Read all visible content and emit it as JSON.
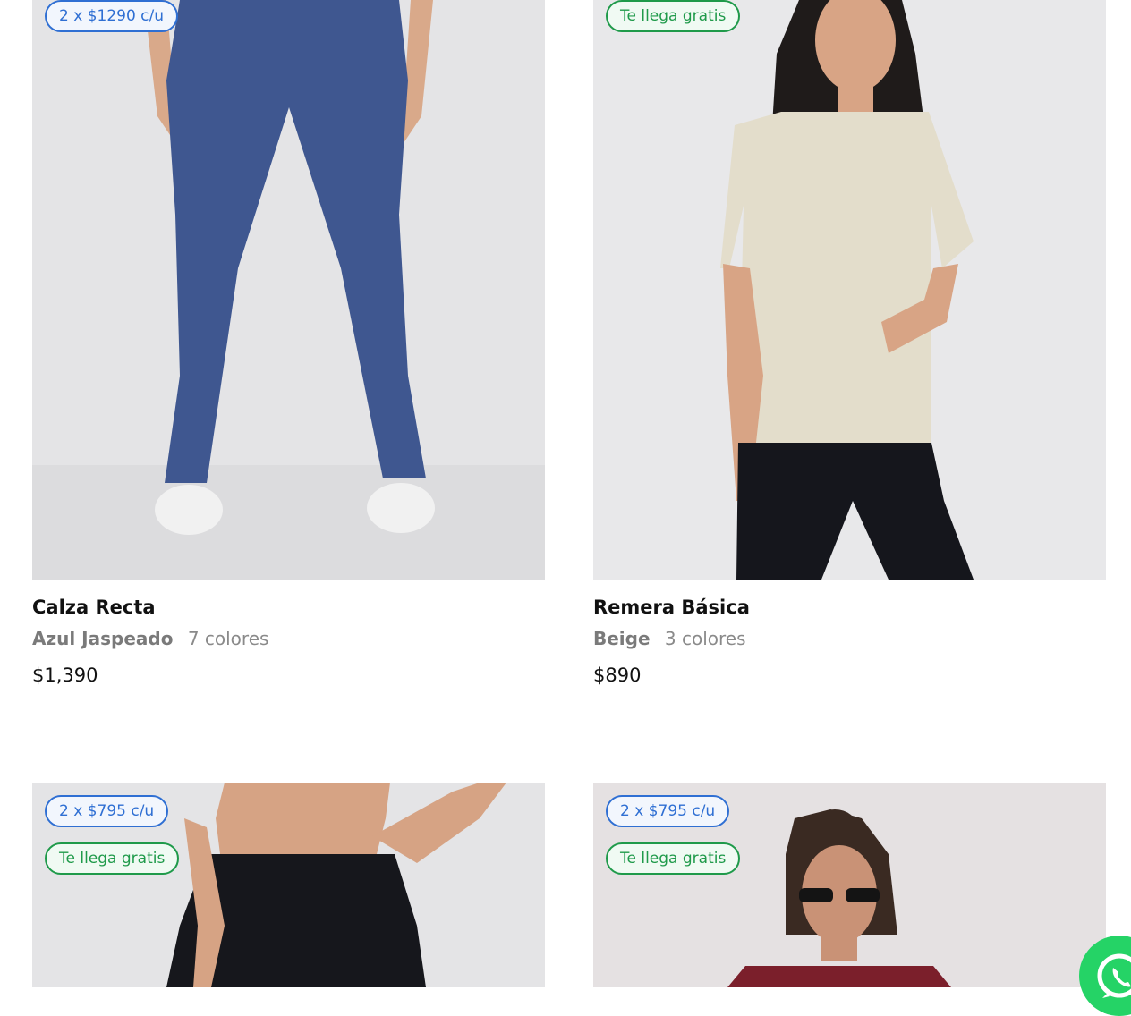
{
  "products": [
    {
      "name": "Calza Recta",
      "color": "Azul Jaspeado",
      "colors_count": "7 colores",
      "price": "$1,390",
      "badges": {
        "promo": "2 x $1290 c/u"
      }
    },
    {
      "name": "Remera Básica",
      "color": "Beige",
      "colors_count": "3 colores",
      "price": "$890",
      "badges": {
        "ship": "Te llega gratis"
      }
    },
    {
      "badges": {
        "promo": "2 x $795 c/u",
        "ship": "Te llega gratis"
      }
    },
    {
      "badges": {
        "promo": "2 x $795 c/u",
        "ship": "Te llega gratis"
      }
    }
  ],
  "colors": {
    "promo_badge": "#2f6fd3",
    "ship_badge": "#1f9a4a",
    "whatsapp": "#25d366"
  },
  "icons": {
    "whatsapp_button": "whatsapp-icon"
  }
}
